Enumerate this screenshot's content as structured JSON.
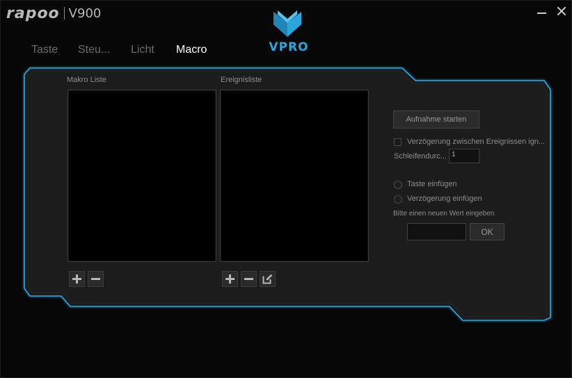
{
  "app": {
    "brand": "rapoo",
    "model": "V900",
    "logo_text": "VPRO"
  },
  "tabs": [
    {
      "label": "Taste"
    },
    {
      "label": "Steu..."
    },
    {
      "label": "Licht"
    },
    {
      "label": "Macro"
    }
  ],
  "macro": {
    "list_label": "Makro Liste",
    "events_label": "Ereignisliste"
  },
  "controls": {
    "record_button": "Aufnahme starten",
    "ignore_delay_label": "Verzögerung zwischen Ereignissen ign...",
    "loop_label": "Schleifendurc...",
    "loop_value": "1",
    "insert_key_label": "Taste einfügen",
    "insert_delay_label": "Verzögerung einfügen",
    "new_value_label": "Bitte einen neuen Wert eingeben",
    "new_value": "",
    "ok_button": "OK"
  },
  "colors": {
    "accent": "#2aa6dc",
    "panel": "#1a1a1a",
    "background": "#070707"
  }
}
